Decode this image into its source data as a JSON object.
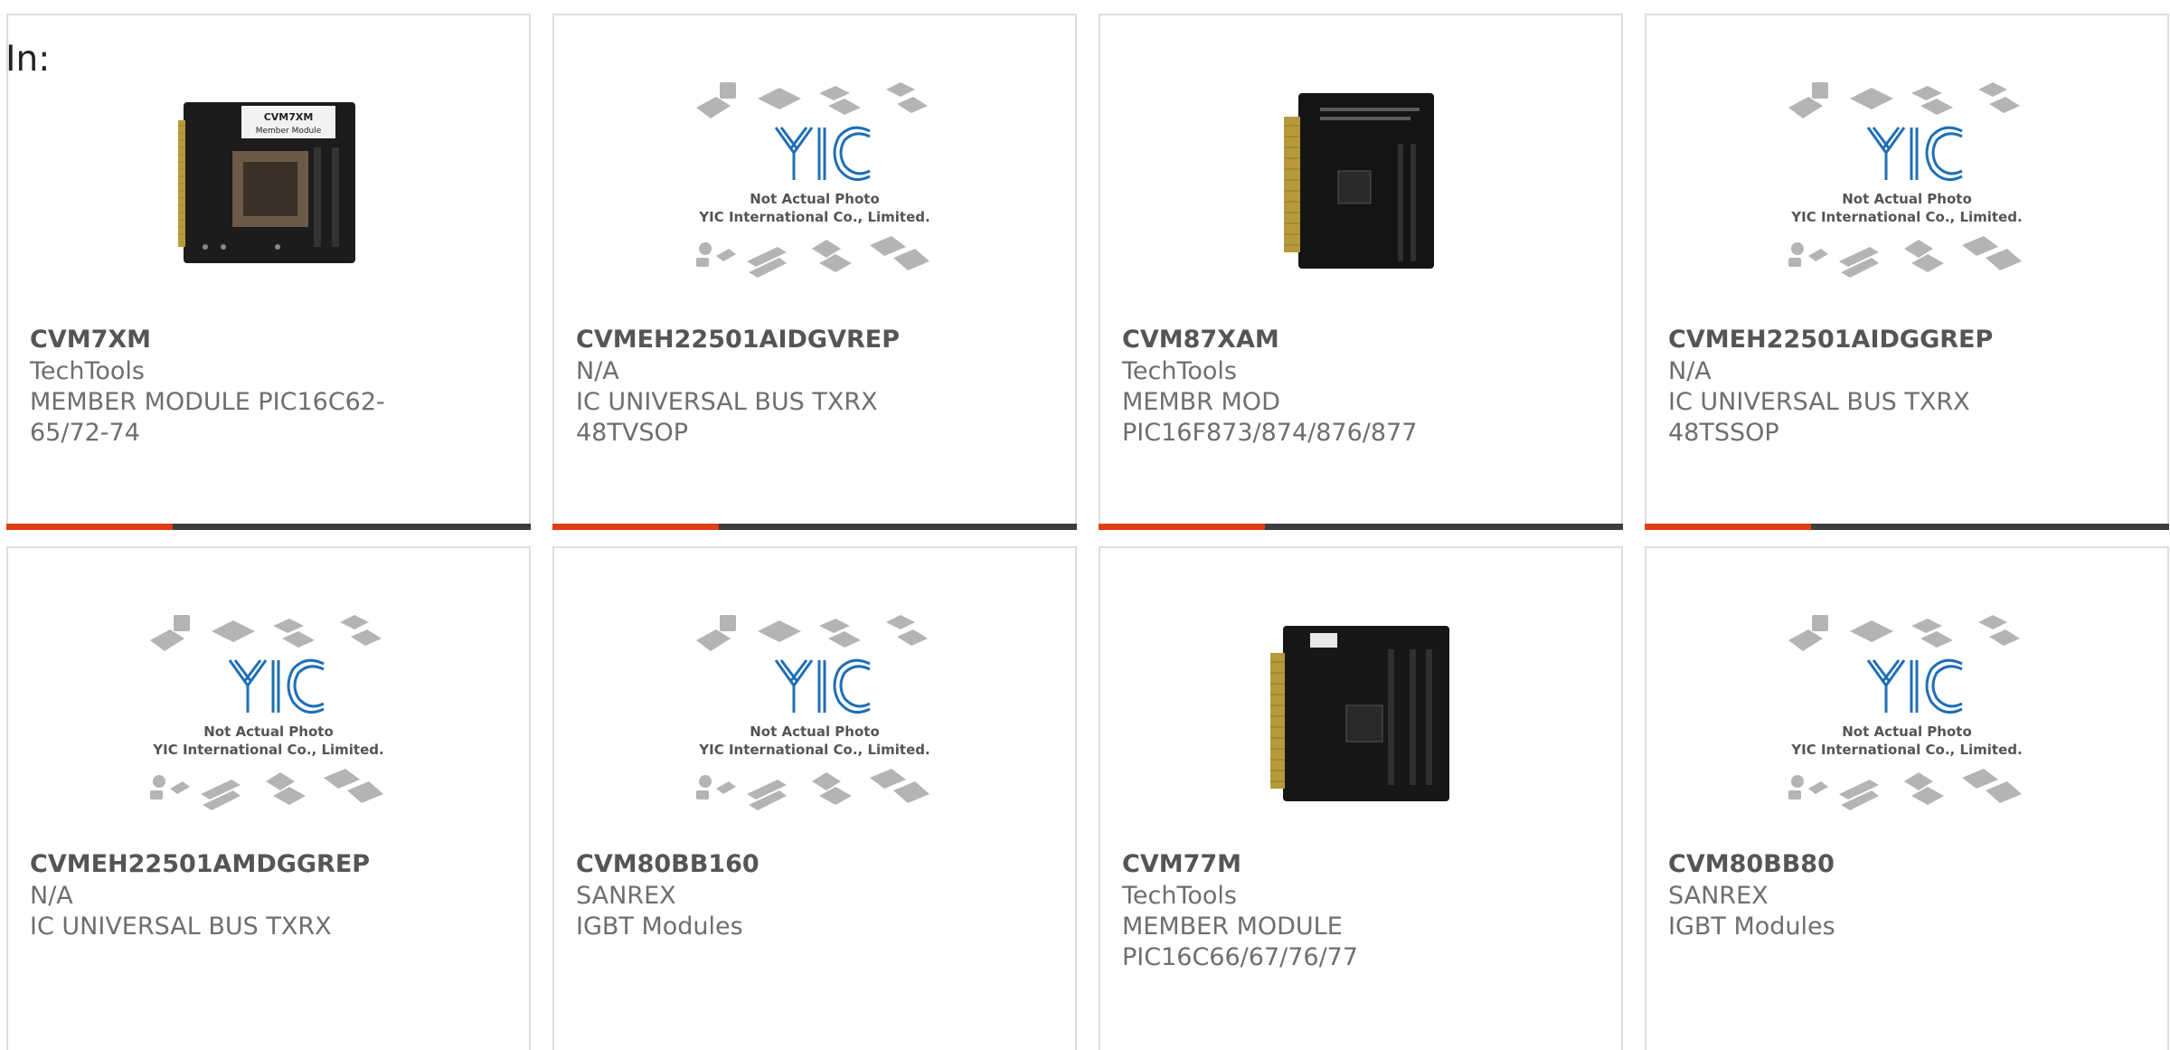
{
  "header": {
    "in_label": "In:"
  },
  "colors": {
    "accent": "#e23c12",
    "bar": "#3d3d3d",
    "title": "#555555",
    "text": "#6e6e6e",
    "border": "#dedede",
    "yic_blue": "#1f6fb5"
  },
  "placeholder": {
    "line1": "Not Actual Photo",
    "line2": "YIC International Co., Limited."
  },
  "products": [
    {
      "part": "CVM7XM",
      "maker": "TechTools",
      "desc": "MEMBER MODULE PIC16C62-65/72-74",
      "image": "board-photo-cvm7xm",
      "board_label": "CVM7XM",
      "board_sublabel": "Member Module"
    },
    {
      "part": "CVMEH22501AIDGVREP",
      "maker": "N/A",
      "desc": "IC UNIVERSAL BUS TXRX 48TVSOP",
      "image": "not-actual-photo"
    },
    {
      "part": "CVM87XAM",
      "maker": "TechTools",
      "desc": "MEMBR MOD PIC16F873/874/876/877",
      "image": "board-photo-cvm87xam"
    },
    {
      "part": "CVMEH22501AIDGGREP",
      "maker": "N/A",
      "desc": "IC UNIVERSAL BUS TXRX 48TSSOP",
      "image": "not-actual-photo"
    },
    {
      "part": "CVMEH22501AMDGGREP",
      "maker": "N/A",
      "desc": "IC UNIVERSAL BUS TXRX",
      "image": "not-actual-photo"
    },
    {
      "part": "CVM80BB160",
      "maker": "SANREX",
      "desc": "IGBT Modules",
      "image": "not-actual-photo"
    },
    {
      "part": "CVM77M",
      "maker": "TechTools",
      "desc": "MEMBER MODULE PIC16C66/67/76/77",
      "image": "board-photo-cvm77m"
    },
    {
      "part": "CVM80BB80",
      "maker": "SANREX",
      "desc": "IGBT Modules",
      "image": "not-actual-photo"
    }
  ]
}
